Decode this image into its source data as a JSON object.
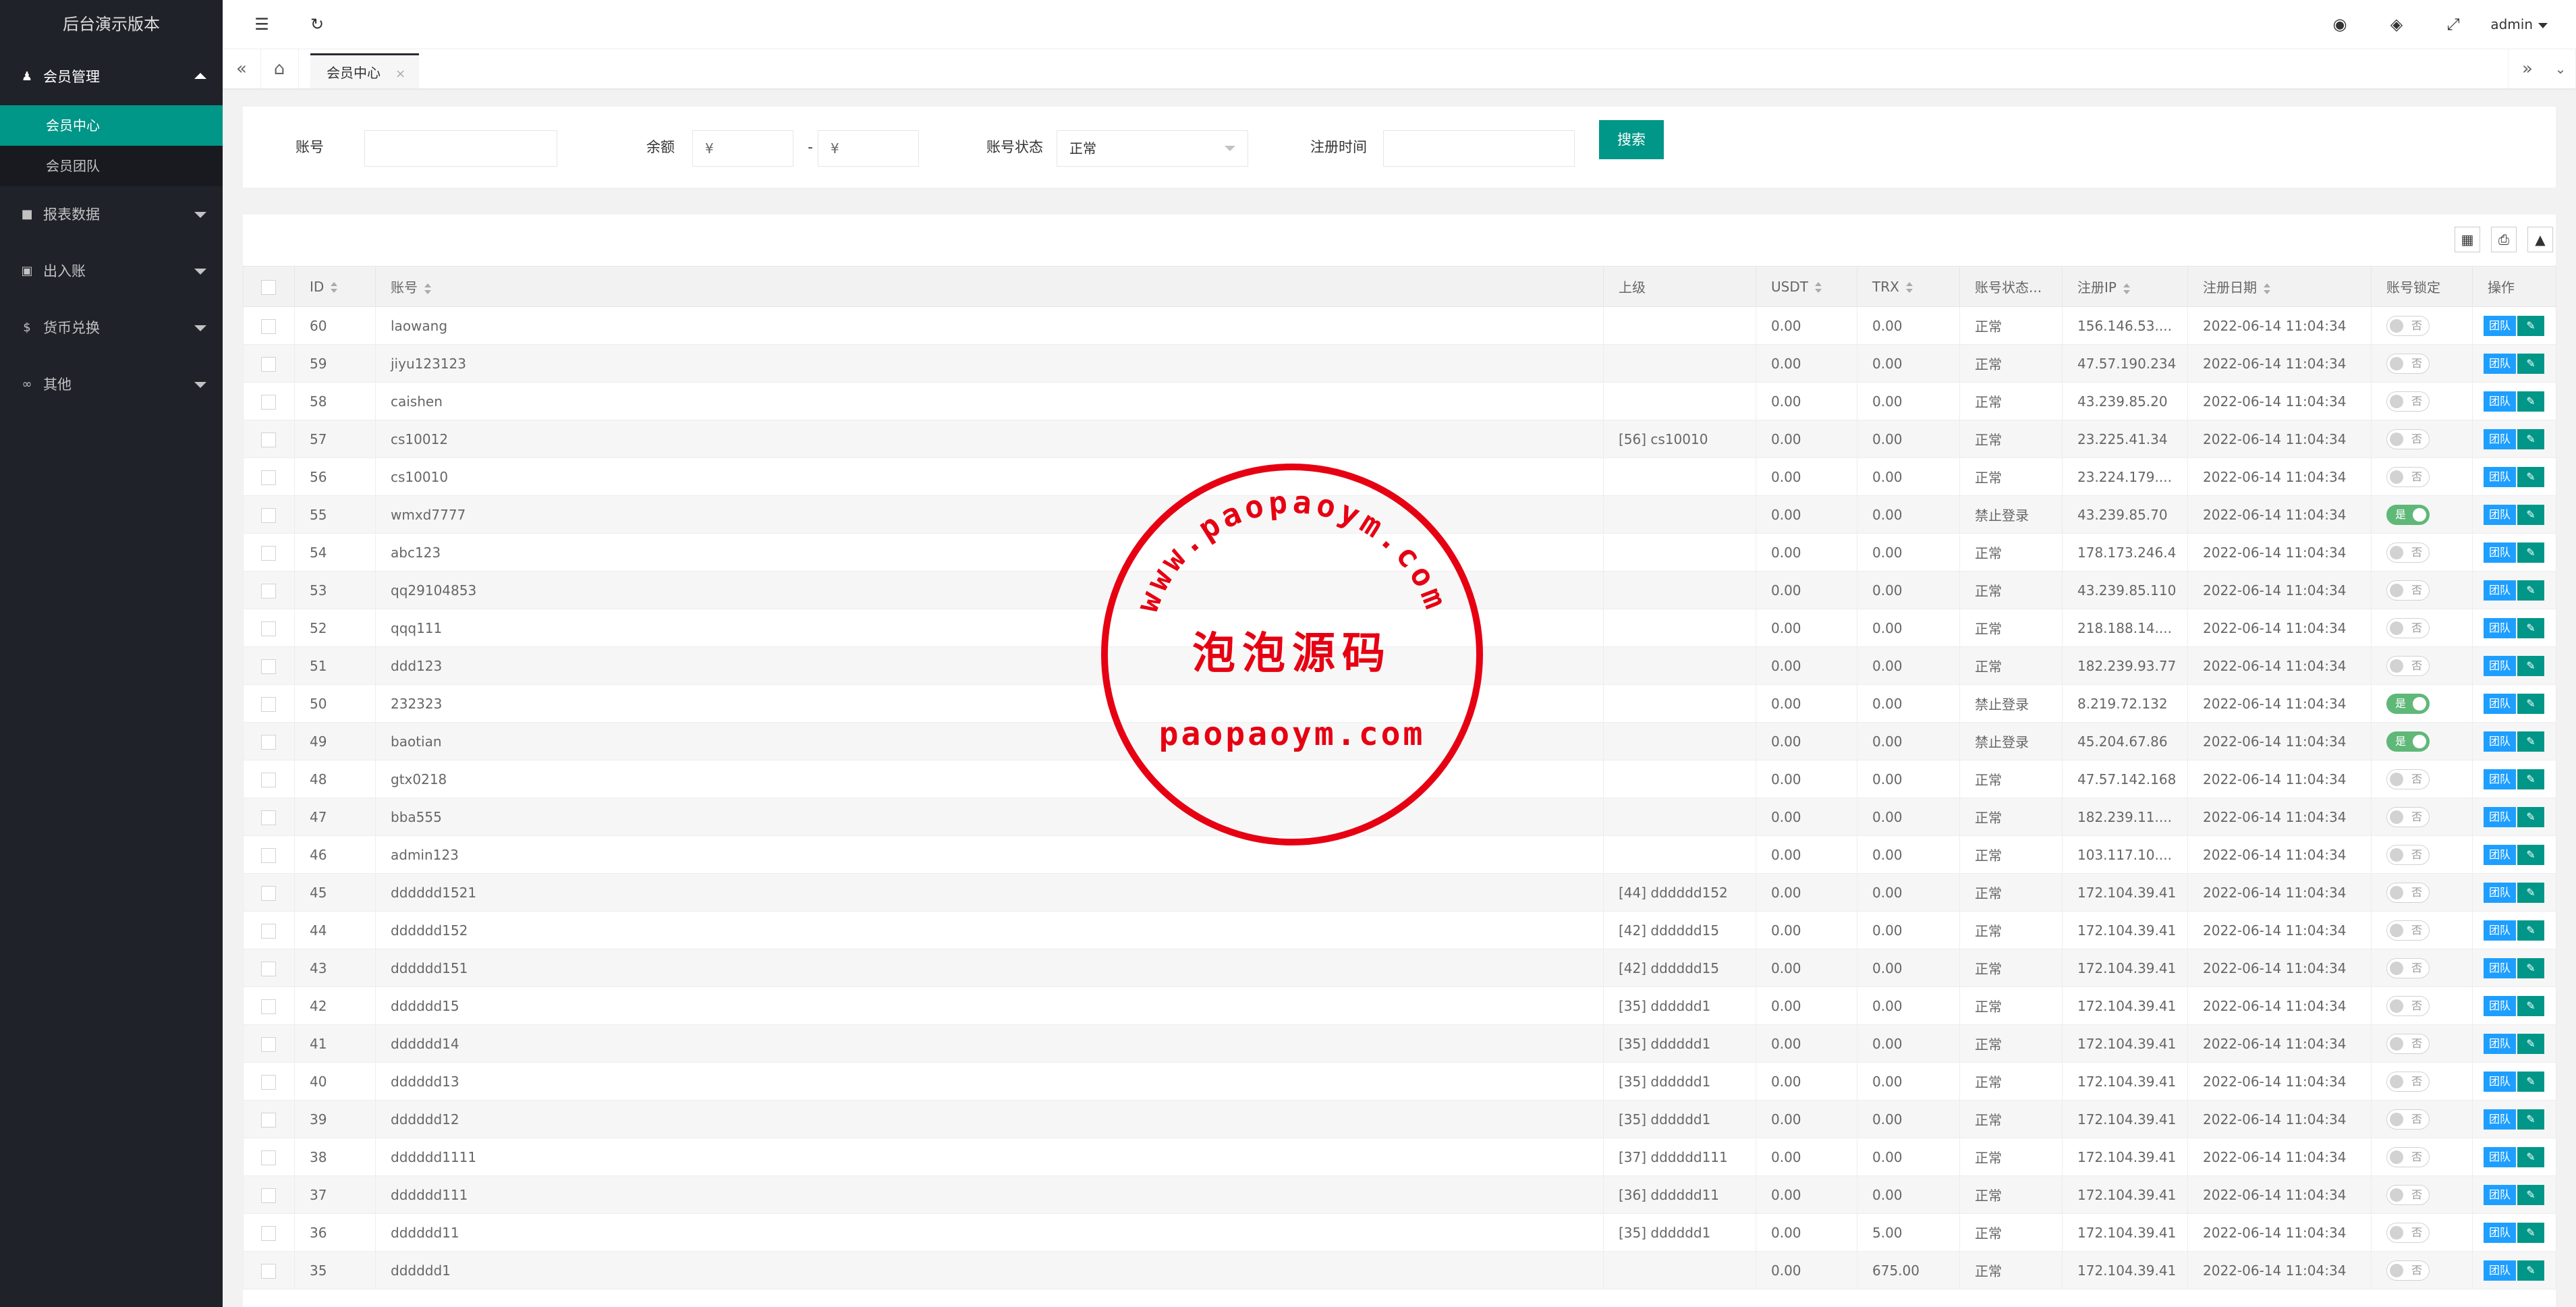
{
  "app": {
    "title": "后台演示版本"
  },
  "sidebar": {
    "groups": [
      {
        "label": "会员管理",
        "icon": "users-icon",
        "open": true,
        "children": [
          {
            "label": "会员中心",
            "active": true
          },
          {
            "label": "会员团队",
            "active": false
          }
        ]
      },
      {
        "label": "报表数据",
        "icon": "chat-icon",
        "open": false
      },
      {
        "label": "出入账",
        "icon": "bank-icon",
        "open": false
      },
      {
        "label": "货币兑换",
        "icon": "dollar-icon",
        "open": false
      },
      {
        "label": "其他",
        "icon": "link-icon",
        "open": false
      }
    ]
  },
  "header": {
    "user": "admin",
    "icons": [
      "menu-fold-icon",
      "refresh-icon",
      "theme-icon",
      "tag-icon",
      "fullscreen-icon"
    ]
  },
  "tabs": {
    "active": "会员中心"
  },
  "search": {
    "account_label": "账号",
    "account_value": "",
    "balance_label": "余额",
    "balance_min_placeholder": "¥",
    "balance_max_placeholder": "¥",
    "range_sep": "-",
    "status_label": "账号状态",
    "status_value": "正常",
    "regtime_label": "注册时间",
    "regtime_value": "",
    "search_button": "搜索"
  },
  "table": {
    "columns": [
      "ID",
      "账号",
      "上级",
      "USDT",
      "TRX",
      "账号状态...",
      "注册IP",
      "注册日期",
      "账号锁定",
      "操作"
    ],
    "switch_off": "否",
    "switch_on": "是",
    "op_team": "团队",
    "op_edit_icon": "pencil-icon",
    "rows": [
      {
        "id": "60",
        "account": "laowang",
        "parent": "",
        "usdt": "0.00",
        "trx": "0.00",
        "status": "正常",
        "ip": "156.146.53....",
        "date": "2022-06-14 11:04:34",
        "locked": false
      },
      {
        "id": "59",
        "account": "jiyu123123",
        "parent": "",
        "usdt": "0.00",
        "trx": "0.00",
        "status": "正常",
        "ip": "47.57.190.234",
        "date": "2022-06-14 11:04:34",
        "locked": false
      },
      {
        "id": "58",
        "account": "caishen",
        "parent": "",
        "usdt": "0.00",
        "trx": "0.00",
        "status": "正常",
        "ip": "43.239.85.20",
        "date": "2022-06-14 11:04:34",
        "locked": false
      },
      {
        "id": "57",
        "account": "cs10012",
        "parent": "[56] cs10010",
        "usdt": "0.00",
        "trx": "0.00",
        "status": "正常",
        "ip": "23.225.41.34",
        "date": "2022-06-14 11:04:34",
        "locked": false
      },
      {
        "id": "56",
        "account": "cs10010",
        "parent": "",
        "usdt": "0.00",
        "trx": "0.00",
        "status": "正常",
        "ip": "23.224.179....",
        "date": "2022-06-14 11:04:34",
        "locked": false
      },
      {
        "id": "55",
        "account": "wmxd7777",
        "parent": "",
        "usdt": "0.00",
        "trx": "0.00",
        "status": "禁止登录",
        "ip": "43.239.85.70",
        "date": "2022-06-14 11:04:34",
        "locked": true
      },
      {
        "id": "54",
        "account": "abc123",
        "parent": "",
        "usdt": "0.00",
        "trx": "0.00",
        "status": "正常",
        "ip": "178.173.246.4",
        "date": "2022-06-14 11:04:34",
        "locked": false
      },
      {
        "id": "53",
        "account": "qq29104853",
        "parent": "",
        "usdt": "0.00",
        "trx": "0.00",
        "status": "正常",
        "ip": "43.239.85.110",
        "date": "2022-06-14 11:04:34",
        "locked": false
      },
      {
        "id": "52",
        "account": "qqq111",
        "parent": "",
        "usdt": "0.00",
        "trx": "0.00",
        "status": "正常",
        "ip": "218.188.14....",
        "date": "2022-06-14 11:04:34",
        "locked": false
      },
      {
        "id": "51",
        "account": "ddd123",
        "parent": "",
        "usdt": "0.00",
        "trx": "0.00",
        "status": "正常",
        "ip": "182.239.93.77",
        "date": "2022-06-14 11:04:34",
        "locked": false
      },
      {
        "id": "50",
        "account": "232323",
        "parent": "",
        "usdt": "0.00",
        "trx": "0.00",
        "status": "禁止登录",
        "ip": "8.219.72.132",
        "date": "2022-06-14 11:04:34",
        "locked": true
      },
      {
        "id": "49",
        "account": "baotian",
        "parent": "",
        "usdt": "0.00",
        "trx": "0.00",
        "status": "禁止登录",
        "ip": "45.204.67.86",
        "date": "2022-06-14 11:04:34",
        "locked": true
      },
      {
        "id": "48",
        "account": "gtx0218",
        "parent": "",
        "usdt": "0.00",
        "trx": "0.00",
        "status": "正常",
        "ip": "47.57.142.168",
        "date": "2022-06-14 11:04:34",
        "locked": false
      },
      {
        "id": "47",
        "account": "bba555",
        "parent": "",
        "usdt": "0.00",
        "trx": "0.00",
        "status": "正常",
        "ip": "182.239.11....",
        "date": "2022-06-14 11:04:34",
        "locked": false
      },
      {
        "id": "46",
        "account": "admin123",
        "parent": "",
        "usdt": "0.00",
        "trx": "0.00",
        "status": "正常",
        "ip": "103.117.10....",
        "date": "2022-06-14 11:04:34",
        "locked": false
      },
      {
        "id": "45",
        "account": "dddddd1521",
        "parent": "[44] dddddd152",
        "usdt": "0.00",
        "trx": "0.00",
        "status": "正常",
        "ip": "172.104.39.41",
        "date": "2022-06-14 11:04:34",
        "locked": false
      },
      {
        "id": "44",
        "account": "dddddd152",
        "parent": "[42] dddddd15",
        "usdt": "0.00",
        "trx": "0.00",
        "status": "正常",
        "ip": "172.104.39.41",
        "date": "2022-06-14 11:04:34",
        "locked": false
      },
      {
        "id": "43",
        "account": "dddddd151",
        "parent": "[42] dddddd15",
        "usdt": "0.00",
        "trx": "0.00",
        "status": "正常",
        "ip": "172.104.39.41",
        "date": "2022-06-14 11:04:34",
        "locked": false
      },
      {
        "id": "42",
        "account": "dddddd15",
        "parent": "[35] dddddd1",
        "usdt": "0.00",
        "trx": "0.00",
        "status": "正常",
        "ip": "172.104.39.41",
        "date": "2022-06-14 11:04:34",
        "locked": false
      },
      {
        "id": "41",
        "account": "dddddd14",
        "parent": "[35] dddddd1",
        "usdt": "0.00",
        "trx": "0.00",
        "status": "正常",
        "ip": "172.104.39.41",
        "date": "2022-06-14 11:04:34",
        "locked": false
      },
      {
        "id": "40",
        "account": "dddddd13",
        "parent": "[35] dddddd1",
        "usdt": "0.00",
        "trx": "0.00",
        "status": "正常",
        "ip": "172.104.39.41",
        "date": "2022-06-14 11:04:34",
        "locked": false
      },
      {
        "id": "39",
        "account": "dddddd12",
        "parent": "[35] dddddd1",
        "usdt": "0.00",
        "trx": "0.00",
        "status": "正常",
        "ip": "172.104.39.41",
        "date": "2022-06-14 11:04:34",
        "locked": false
      },
      {
        "id": "38",
        "account": "dddddd1111",
        "parent": "[37] dddddd111",
        "usdt": "0.00",
        "trx": "0.00",
        "status": "正常",
        "ip": "172.104.39.41",
        "date": "2022-06-14 11:04:34",
        "locked": false
      },
      {
        "id": "37",
        "account": "dddddd111",
        "parent": "[36] dddddd11",
        "usdt": "0.00",
        "trx": "0.00",
        "status": "正常",
        "ip": "172.104.39.41",
        "date": "2022-06-14 11:04:34",
        "locked": false
      },
      {
        "id": "36",
        "account": "dddddd11",
        "parent": "[35] dddddd1",
        "usdt": "0.00",
        "trx": "5.00",
        "status": "正常",
        "ip": "172.104.39.41",
        "date": "2022-06-14 11:04:34",
        "locked": false
      },
      {
        "id": "35",
        "account": "dddddd1",
        "parent": "",
        "usdt": "0.00",
        "trx": "675.00",
        "status": "正常",
        "ip": "172.104.39.41",
        "date": "2022-06-14 11:04:34",
        "locked": false
      }
    ]
  },
  "watermark": {
    "url_text": "www.paopaoym.com",
    "name": "泡泡源码",
    "domain": "paopaoym.com",
    "color": "#e60012"
  },
  "colors": {
    "sidebar_bg": "#20222a",
    "accent": "#009688",
    "team_btn": "#1e9fff",
    "switch_on": "#5fb878"
  }
}
